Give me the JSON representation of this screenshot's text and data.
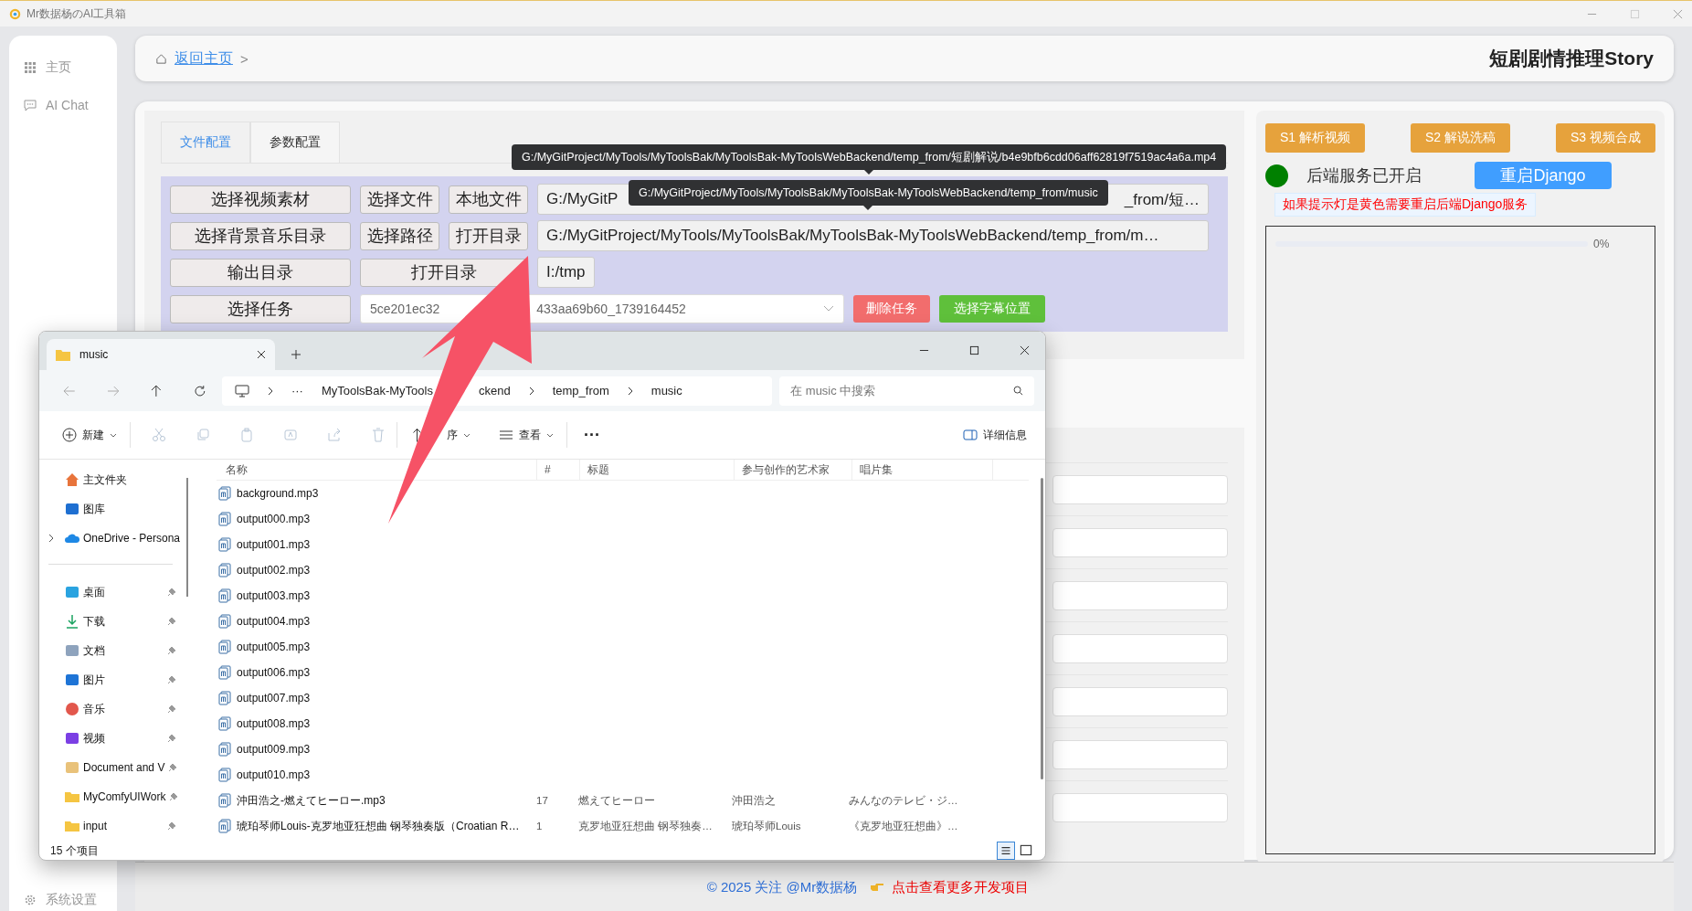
{
  "app": {
    "title": "Mr数据杨のAI工具箱"
  },
  "sidebar": {
    "items": [
      {
        "label": "主页"
      },
      {
        "label": "AI Chat"
      }
    ],
    "footer_item": {
      "label": "系统设置"
    }
  },
  "header": {
    "breadcrumb": "返回主页",
    "separator": ">",
    "title": "短剧剧情推理Story"
  },
  "config": {
    "tabs": [
      {
        "label": "文件配置",
        "selected": true
      },
      {
        "label": "参数配置",
        "selected": false
      }
    ],
    "rows": [
      {
        "button": "选择视频素材",
        "actions": [
          "选择文件",
          "本地文件"
        ],
        "path_start": "G:/MyGitP",
        "path_end": "_from/短…"
      },
      {
        "button": "选择背景音乐目录",
        "actions": [
          "选择路径",
          "打开目录"
        ],
        "path": "G:/MyGitProject/MyTools/MyToolsBak/MyToolsBak-MyToolsWebBackend/temp_from/m…"
      },
      {
        "button": "输出目录",
        "actions": [
          "打开目录"
        ],
        "path": "I:/tmp"
      }
    ],
    "task_row": {
      "button": "选择任务",
      "value_start": "5ce201ec32",
      "value_end": "433aa69b60_1739164452",
      "actions": [
        {
          "label": "删除任务",
          "kind": "danger"
        },
        {
          "label": "选择字幕位置",
          "kind": "success"
        }
      ]
    },
    "tooltips": [
      "G:/MyGitProject/MyTools/MyToolsBak/MyToolsBak-MyToolsWebBackend/temp_from/短剧解说/b4e9bfb6cdd06aff62819f7519ac4a6a.mp4",
      "G:/MyGitProject/MyTools/MyToolsBak/MyToolsBak-MyToolsWebBackend/temp_from/music"
    ]
  },
  "side_panel": {
    "steps": [
      "S1 解析视频",
      "S2 解说洗稿",
      "S3 视频合成"
    ],
    "status": {
      "color": "#008000",
      "label": "后端服务已开启"
    },
    "restart_button": "重启Django",
    "note": "如果提示灯是黄色需要重启后端Django服务",
    "progress": {
      "level": 0,
      "reading": "0%"
    }
  },
  "footer": {
    "link": "© 2025 关注 @Mr数据杨",
    "promo": "点击查看更多开发项目"
  },
  "explorer": {
    "tab": "music",
    "address": {
      "more": "···",
      "parts": [
        "MyToolsBak-MyTools",
        "ckend",
        "temp_from",
        "music"
      ]
    },
    "search": {
      "placeholder": "在 music 中搜索"
    },
    "toolbar": {
      "new": "新建",
      "sort": "序",
      "view": "查看",
      "more": "···",
      "details": "详细信息"
    },
    "nav": [
      {
        "label": "主文件夹",
        "kind": "home",
        "pinned": false
      },
      {
        "label": "图库",
        "kind": "gallery",
        "pinned": false
      },
      {
        "label": "OneDrive - Persona",
        "kind": "cloud",
        "pinned": false,
        "expanded": false
      },
      {
        "label": "桌面",
        "kind": "desktop",
        "pinned": true
      },
      {
        "label": "下载",
        "kind": "download",
        "pinned": true
      },
      {
        "label": "文档",
        "kind": "document",
        "pinned": true
      },
      {
        "label": "图片",
        "kind": "pictures",
        "pinned": true
      },
      {
        "label": "音乐",
        "kind": "music",
        "pinned": true
      },
      {
        "label": "视频",
        "kind": "video",
        "pinned": true
      },
      {
        "label": "Document and V",
        "kind": "archive",
        "pinned": true
      },
      {
        "label": "MyComfyUIWork",
        "kind": "folder",
        "pinned": true
      },
      {
        "label": "input",
        "kind": "folder",
        "pinned": true
      }
    ],
    "columns": [
      "名称",
      "#",
      "标题",
      "参与创作的艺术家",
      "唱片集"
    ],
    "files": [
      {
        "name": "background.mp3"
      },
      {
        "name": "output000.mp3"
      },
      {
        "name": "output001.mp3"
      },
      {
        "name": "output002.mp3"
      },
      {
        "name": "output003.mp3"
      },
      {
        "name": "output004.mp3"
      },
      {
        "name": "output005.mp3"
      },
      {
        "name": "output006.mp3"
      },
      {
        "name": "output007.mp3"
      },
      {
        "name": "output008.mp3"
      },
      {
        "name": "output009.mp3"
      },
      {
        "name": "output010.mp3"
      },
      {
        "name": "沖田浩之-燃えてヒーロー.mp3",
        "track": "17",
        "title": "燃えてヒーロー",
        "artist": "沖田浩之",
        "album": "みんなのテレビ・ジ…"
      },
      {
        "name": "琥珀琴师Louis-克罗地亚狂想曲 钢琴独奏版（Croatian R…",
        "track": "1",
        "title": "克罗地亚狂想曲 钢琴独奏…",
        "artist": "琥珀琴师Louis",
        "album": "《克罗地亚狂想曲》…"
      }
    ],
    "status": "15 个项目",
    "view_modes": [
      {
        "selected": true
      },
      {
        "selected": false
      }
    ]
  }
}
